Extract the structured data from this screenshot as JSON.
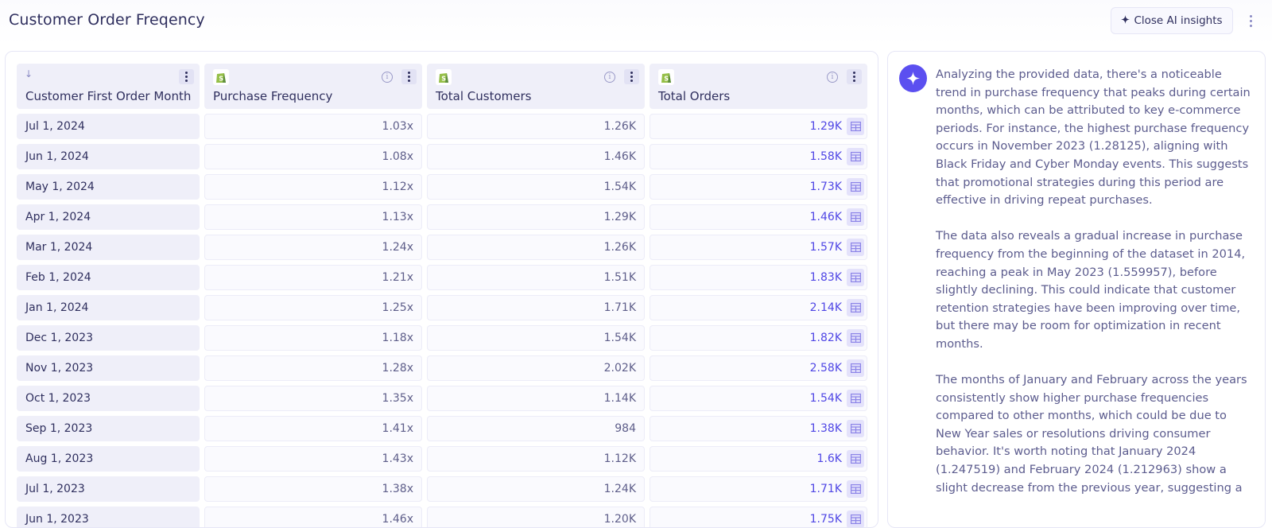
{
  "header": {
    "title": "Customer Order Freqency",
    "close_ai_label": "Close AI insights",
    "close_ai_icon": "sparkle-icon",
    "more_icon": "vertical-ellipsis-icon"
  },
  "colors": {
    "accent": "#4f46e5",
    "ai_avatar": "#5b4ff0",
    "header_bg": "#efeff9",
    "text": "#2f2f5e",
    "shopify_green": "#95bf47"
  },
  "table": {
    "columns": [
      {
        "label": "Customer First Order Month",
        "icon": "sort-desc-arrow-icon",
        "has_info": false
      },
      {
        "label": "Purchase Frequency",
        "icon": "shopify-logo-icon",
        "has_info": true
      },
      {
        "label": "Total Customers",
        "icon": "shopify-logo-icon",
        "has_info": true
      },
      {
        "label": "Total Orders",
        "icon": "shopify-logo-icon",
        "has_info": true
      }
    ],
    "rows": [
      {
        "month": "Jul 1, 2024",
        "frequency": "1.03x",
        "customers": "1.26K",
        "orders": "1.29K"
      },
      {
        "month": "Jun 1, 2024",
        "frequency": "1.08x",
        "customers": "1.46K",
        "orders": "1.58K"
      },
      {
        "month": "May 1, 2024",
        "frequency": "1.12x",
        "customers": "1.54K",
        "orders": "1.73K"
      },
      {
        "month": "Apr 1, 2024",
        "frequency": "1.13x",
        "customers": "1.29K",
        "orders": "1.46K"
      },
      {
        "month": "Mar 1, 2024",
        "frequency": "1.24x",
        "customers": "1.26K",
        "orders": "1.57K"
      },
      {
        "month": "Feb 1, 2024",
        "frequency": "1.21x",
        "customers": "1.51K",
        "orders": "1.83K"
      },
      {
        "month": "Jan 1, 2024",
        "frequency": "1.25x",
        "customers": "1.71K",
        "orders": "2.14K"
      },
      {
        "month": "Dec 1, 2023",
        "frequency": "1.18x",
        "customers": "1.54K",
        "orders": "1.82K"
      },
      {
        "month": "Nov 1, 2023",
        "frequency": "1.28x",
        "customers": "2.02K",
        "orders": "2.58K"
      },
      {
        "month": "Oct 1, 2023",
        "frequency": "1.35x",
        "customers": "1.14K",
        "orders": "1.54K"
      },
      {
        "month": "Sep 1, 2023",
        "frequency": "1.41x",
        "customers": "984",
        "orders": "1.38K"
      },
      {
        "month": "Aug 1, 2023",
        "frequency": "1.43x",
        "customers": "1.12K",
        "orders": "1.6K"
      },
      {
        "month": "Jul 1, 2023",
        "frequency": "1.38x",
        "customers": "1.24K",
        "orders": "1.71K"
      },
      {
        "month": "Jun 1, 2023",
        "frequency": "1.46x",
        "customers": "1.20K",
        "orders": "1.75K"
      }
    ]
  },
  "ai_insights": {
    "avatar_icon": "sparkle-icon",
    "paragraphs": [
      "Analyzing the provided data, there's a noticeable trend in purchase frequency that peaks during certain months, which can be attributed to key e-commerce periods. For instance, the highest purchase frequency occurs in November 2023 (1.28125), aligning with Black Friday and Cyber Monday events. This suggests that promotional strategies during this period are effective in driving repeat purchases.",
      "The data also reveals a gradual increase in purchase frequency from the beginning of the dataset in 2014, reaching a peak in May 2023 (1.559957), before slightly declining. This could indicate that customer retention strategies have been improving over time, but there may be room for optimization in recent months.",
      "The months of January and February across the years consistently show higher purchase frequencies compared to other months, which could be due to New Year sales or resolutions driving consumer behavior. It's worth noting that January 2024 (1.247519) and February 2024 (1.212963) show a slight decrease from the previous year, suggesting a"
    ]
  }
}
